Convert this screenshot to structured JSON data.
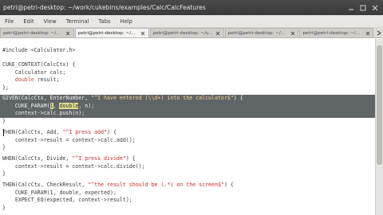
{
  "window": {
    "title": "petri@petri-desktop: ~/work/cukebins/examples/Calc/CalcFeatures"
  },
  "menu": {
    "items": [
      "File",
      "Edit",
      "View",
      "Terminal",
      "Tabs",
      "Help"
    ]
  },
  "tabs": [
    {
      "label": "petri@petri-desktop: ~/...",
      "active": false
    },
    {
      "label": "petri@petri-desktop: ~/...",
      "active": true
    },
    {
      "label": "petri@petri-desktop: ~/u...",
      "active": false
    },
    {
      "label": "petri@petri-desktop: ~/...",
      "active": false
    },
    {
      "label": "petri@petri-desktop: ~/...",
      "active": false
    }
  ],
  "code": {
    "l01": "#include <Calculator.h>",
    "l02": "",
    "l03": "CUKE_CONTEXT(CalcCtx) {",
    "l04": "    Calculator calc;",
    "l05a": "    ",
    "l05b": "double",
    "l05c": " result;",
    "l06": "};",
    "l07": "",
    "l08a": "GIVEN(CalcCtx, EnterNumber, ",
    "l08b": "\"^I have entered (\\\\d+) into the calculator$\"",
    "l08c": ") {",
    "l09a": "    CUKE_PARAM(",
    "l09b": "1",
    "l09c": ", ",
    "l09d": "double",
    "l09e": ", n);",
    "l10": "    context->calc.push(n);",
    "l11": "}",
    "l12": "",
    "l13a": "THEN(CalcCtx, Add, ",
    "l13b": "\"^I press add\"",
    "l13c": ") {",
    "l14": "    context->result = context->calc.add();",
    "l15": "}",
    "l16": "",
    "l17a": "WHEN(CalcCtx, Divide, ",
    "l17b": "\"^I press divide\"",
    "l17c": ") {",
    "l18": "    context->result = context->calc.divide();",
    "l19": "}",
    "l20": "",
    "l21a": "THEN(CalcCtx, CheckResult, ",
    "l21b": "\"^the result should be (.*) on the screen$\"",
    "l21c": ") {",
    "l22": "    CUKE_PARAM(1, double, expected);",
    "l23": "    EXPECT_EQ(expected, context->result);",
    "l24": "}"
  },
  "colors": {
    "titlebar": "#3a3a3a",
    "menubar": "#e9e7e3",
    "highlight": "#5f6467",
    "string": "#cc2a2a",
    "keyword": "#b84a26"
  }
}
